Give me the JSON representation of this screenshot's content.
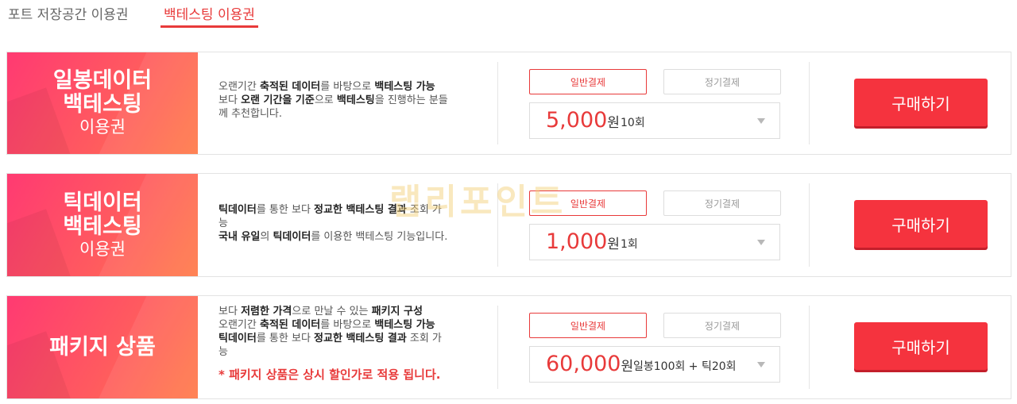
{
  "tabs": [
    {
      "label": "포트 저장공간 이용권",
      "active": false
    },
    {
      "label": "백테스팅 이용권",
      "active": true
    }
  ],
  "colors": {
    "accent": "#e83a3a",
    "buy": "#f5333e",
    "banner_start": "#ff3a72",
    "banner_end": "#ff7a47"
  },
  "payment_labels": {
    "normal": "일반결제",
    "regular": "정기결제"
  },
  "buy_label": "구매하기",
  "watermark": "랩리포인트",
  "products": [
    {
      "banner_title_1": "일봉데이터",
      "banner_title_2": "백테스팅",
      "banner_sub": "이용권",
      "desc_lines": [
        [
          "오랜기간 ",
          "축적된 데이터",
          "를 바탕으로 ",
          "백테스팅 가능"
        ],
        [
          "보다 ",
          "오랜 기간을 기준",
          "으로 ",
          "백테스팅",
          "을 진행하는 분들"
        ],
        [
          "께 추천합니다."
        ]
      ],
      "price": "5,000",
      "unit": "원",
      "count": "10회"
    },
    {
      "banner_title_1": "틱데이터",
      "banner_title_2": "백테스팅",
      "banner_sub": "이용권",
      "desc_lines": [
        [
          "틱데이터",
          "를 통한 보다 ",
          "정교한 백테스팅 결과",
          " 조회 가"
        ],
        [
          "능"
        ],
        [
          "국내 유일",
          "의 ",
          "틱데이터",
          "를 이용한 백테스팅 기능입니다."
        ]
      ],
      "price": "1,000",
      "unit": "원",
      "count": "1회"
    },
    {
      "banner_title_1": "패키지 상품",
      "banner_title_2": "",
      "banner_sub": "",
      "desc_lines": [
        [
          "보다 ",
          "저렴한 가격",
          "으로 만날 수 있는 ",
          "패키지 구성"
        ],
        [
          "오랜기간 ",
          "축적된 데이터",
          "를 바탕으로 ",
          "백테스팅 가능"
        ],
        [
          "틱데이터",
          "를 통한 보다 ",
          "정교한 백테스팅 결과",
          " 조회 가"
        ],
        [
          "능"
        ]
      ],
      "note": "* 패키지 상품은 상시 할인가로 적용 됩니다.",
      "price": "60,000",
      "unit": "원",
      "count": "일봉100회 + 틱20회"
    }
  ]
}
